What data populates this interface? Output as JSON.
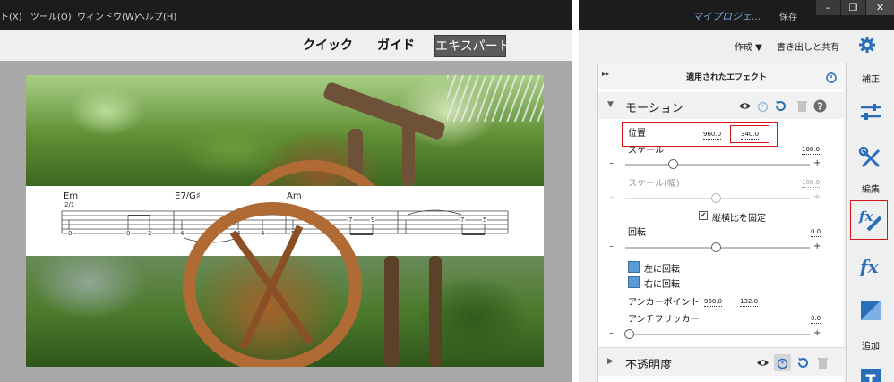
{
  "menubar": {
    "items": [
      "ト(X)",
      "ツール(O)",
      "ウィンドウ(W)",
      "ヘルプ(H)"
    ]
  },
  "modes": {
    "quick": "クイック",
    "guided": "ガイド",
    "expert": "エキスパート",
    "active": "expert"
  },
  "tab": {
    "chords": [
      "Em",
      "E7/G♯",
      "Am"
    ],
    "marker": "2/1",
    "frets": [
      "0",
      "0",
      "2",
      "4",
      "4",
      "4",
      "5",
      "7",
      "9",
      "7",
      "5"
    ]
  },
  "window": {
    "project_title": "マイプロジェ...",
    "save": "保存",
    "buttons": [
      "–",
      "❐",
      "✕"
    ]
  },
  "toolbar": {
    "create": "作成 ▼",
    "export": "書き出しと共有"
  },
  "effects_panel": {
    "title": "適用されたエフェクト",
    "motion": {
      "title": "モーション",
      "position_label": "位置",
      "position_x": "960.0",
      "position_y": "340.0",
      "scale_label": "スケール",
      "scale_value": "100.0",
      "scale_width_label": "スケール(幅)",
      "scale_width_value": "100.0",
      "uniform_scale_label": "縦横比を固定",
      "uniform_scale_checked": true,
      "rotation_label": "回転",
      "rotation_value": "0.0",
      "rotate_left": "左に回転",
      "rotate_right": "右に回転",
      "anchor_label": "アンカーポイント",
      "anchor_x": "960.0",
      "anchor_y": "132.0",
      "antiflicker_label": "アンチフリッカー",
      "antiflicker_value": "0.0"
    },
    "opacity": {
      "title": "不透明度"
    }
  },
  "sidebar": {
    "correct": "補正",
    "edit": "編集",
    "add": "追加"
  },
  "colors": {
    "accent_blue": "#2a6ebb",
    "highlight_red": "#d6141a",
    "dark_chrome": "#1c1c1c"
  }
}
